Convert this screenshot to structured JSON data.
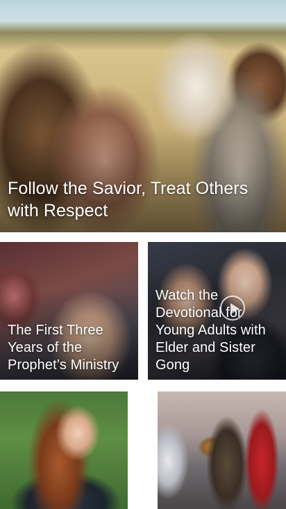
{
  "feed": {
    "hero": {
      "title": "Follow the Savior, Treat Others with Respect"
    },
    "cards": [
      {
        "title": "The First Three Years of the Prophet’s Ministry"
      },
      {
        "title": "Watch the Devotional for Young Adults with Elder and Sister Gong",
        "has_video": true
      },
      {
        "title": ""
      },
      {
        "title": ""
      }
    ]
  }
}
